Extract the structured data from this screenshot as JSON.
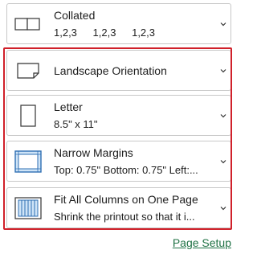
{
  "collation": {
    "title": "Collated",
    "sequence": [
      "1,2,3",
      "1,2,3",
      "1,2,3"
    ],
    "icon": "collated-pages-icon"
  },
  "orientation": {
    "title": "Landscape Orientation",
    "icon": "landscape-page-icon"
  },
  "paper_size": {
    "title": "Letter",
    "detail": "8.5\" x 11\"",
    "icon": "portrait-page-icon"
  },
  "margins": {
    "title": "Narrow Margins",
    "detail": "Top: 0.75\" Bottom: 0.75\" Left:...",
    "icon": "narrow-margins-icon"
  },
  "scaling": {
    "title": "Fit All Columns on One Page",
    "detail": "Shrink the printout so that it i...",
    "icon": "fit-columns-icon"
  },
  "page_setup_link": "Page Setup",
  "colors": {
    "highlight": "#d0202a",
    "link": "#217346",
    "icon_blue": "#2f6fb3",
    "icon_fill": "#cfe4f7"
  }
}
